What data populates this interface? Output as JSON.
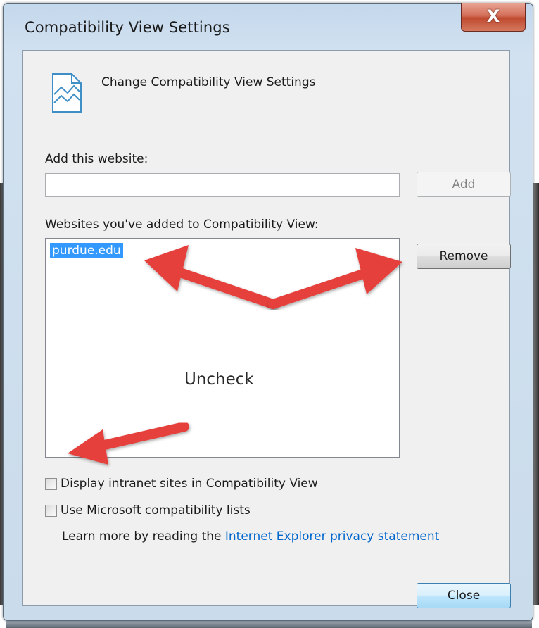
{
  "window": {
    "title": "Compatibility View Settings",
    "close_glyph": "X"
  },
  "header": {
    "icon": "compatibility-view-page-icon",
    "text": "Change Compatibility View Settings"
  },
  "add_section": {
    "label": "Add this website:",
    "input_value": "",
    "add_button_label": "Add",
    "add_button_enabled": false
  },
  "list_section": {
    "label": "Websites you've added to Compatibility View:",
    "items": [
      "purdue.edu"
    ],
    "selected_index": 0,
    "remove_button_label": "Remove"
  },
  "options": {
    "intranet_label": "Display intranet sites in Compatibility View",
    "intranet_checked": false,
    "ms_lists_label": "Use Microsoft compatibility lists",
    "ms_lists_checked": false
  },
  "footer": {
    "learn_more_prefix": "Learn more by reading the ",
    "learn_more_link": "Internet Explorer privacy statement",
    "close_button_label": "Close"
  },
  "annotation": {
    "text": "Uncheck",
    "arrow_color": "#e5403a"
  },
  "colors": {
    "selection": "#3399ff",
    "link": "#0066cc",
    "frame": "#cadbeb"
  }
}
